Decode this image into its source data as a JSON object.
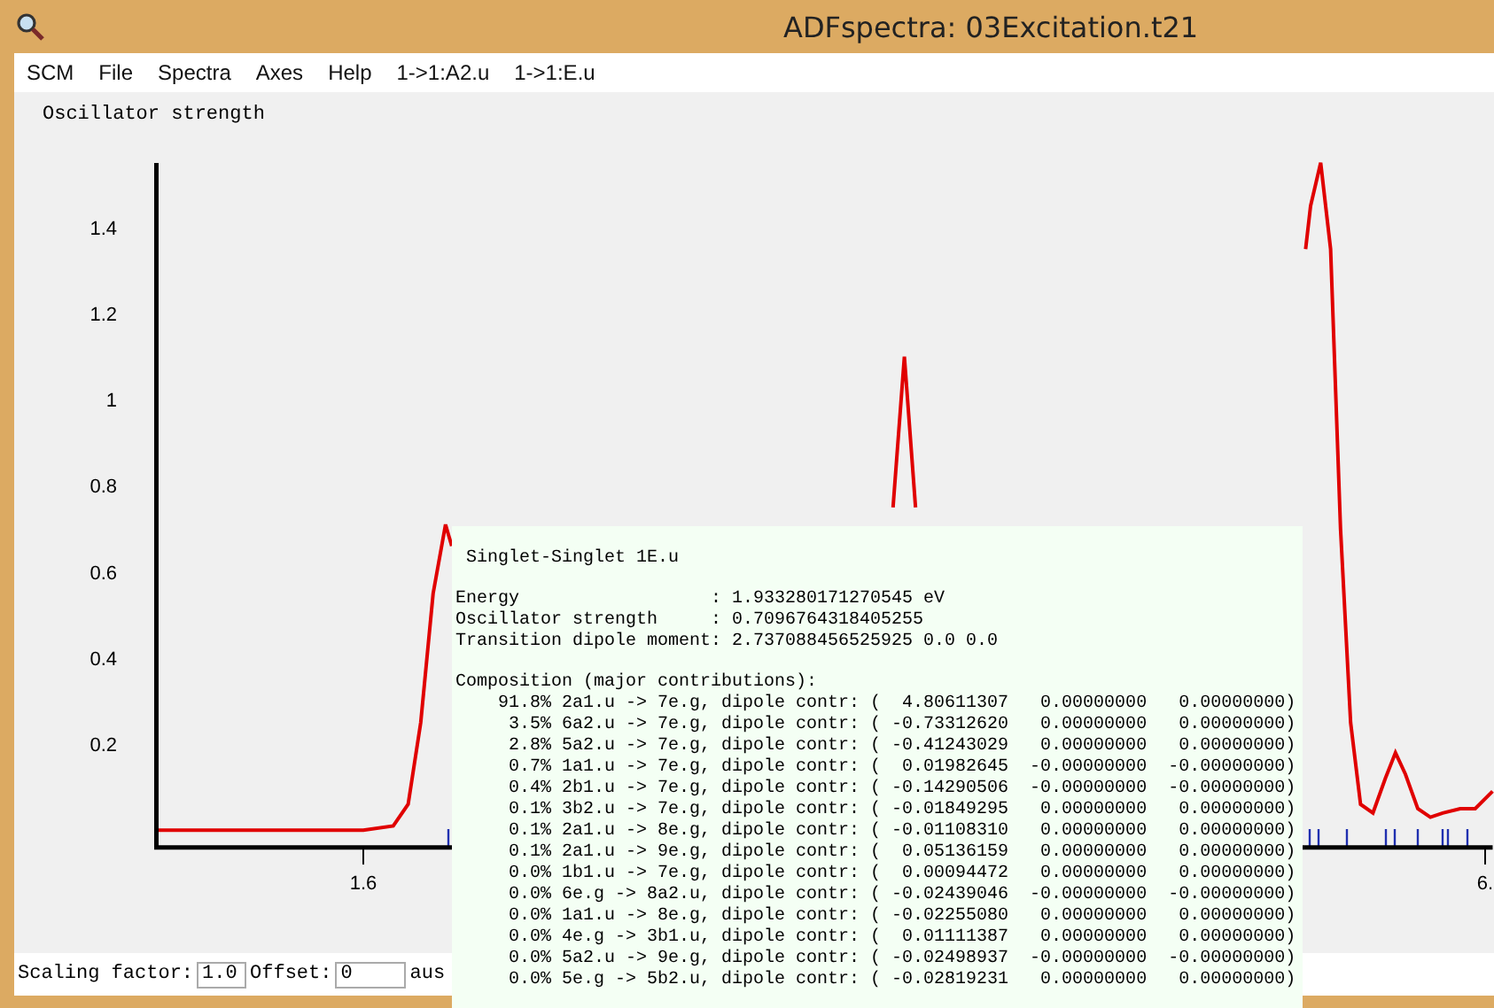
{
  "window": {
    "title": "ADFspectra: 03Excitation.t21"
  },
  "menu": [
    "SCM",
    "File",
    "Spectra",
    "Axes",
    "Help",
    "1->1:A2.u",
    "1->1:E.u"
  ],
  "plot": {
    "chart_data": {
      "type": "line",
      "ylabel": "Oscillator strength",
      "xlim": [
        0.77,
        6.13
      ],
      "ylim": [
        -0.04,
        1.55
      ],
      "yticks": [
        0.2,
        0.4,
        0.6,
        0.8,
        1.0,
        1.2,
        1.4
      ],
      "xticks": [
        1.6,
        {
          "value": 6.1,
          "label": "6."
        }
      ],
      "x": [
        0.77,
        1.6,
        1.72,
        1.78,
        1.83,
        1.88,
        1.93,
        1.955,
        2.0,
        3.7,
        3.725,
        3.77,
        3.815,
        3.84,
        5.0,
        5.38,
        5.4,
        5.44,
        5.48,
        5.52,
        5.56,
        5.6,
        5.65,
        5.7,
        5.74,
        5.78,
        5.83,
        5.88,
        5.93,
        6.0,
        6.06,
        6.13
      ],
      "series": [
        {
          "color": "#e00000",
          "values": [
            0,
            0,
            0.01,
            0.06,
            0.25,
            0.55,
            0.71,
            0.66,
            null,
            null,
            0.75,
            1.1,
            0.75,
            null,
            null,
            1.35,
            1.45,
            1.55,
            1.35,
            0.7,
            0.25,
            0.06,
            0.04,
            0.12,
            0.18,
            0.13,
            0.05,
            0.03,
            0.04,
            0.05,
            0.05,
            0.09
          ]
        }
      ]
    }
  },
  "bottom_bar": {
    "scaling_label": "Scaling factor:",
    "scaling_value": "1.0",
    "offset_label": "Offset:",
    "offset_value": "0",
    "gauss_label": "aus"
  },
  "popup": {
    "title": " Singlet-Singlet 1E.u",
    "properties": [
      "Energy                  : 1.933280171270545 eV",
      "Oscillator strength     : 0.7096764318405255",
      "Transition dipole moment: 2.737088456525925 0.0 0.0"
    ],
    "composition_title": "Composition (major contributions):",
    "composition": [
      "    91.8% 2a1.u -> 7e.g, dipole contr: (  4.80611307   0.00000000   0.00000000)",
      "     3.5% 6a2.u -> 7e.g, dipole contr: ( -0.73312620   0.00000000   0.00000000)",
      "     2.8% 5a2.u -> 7e.g, dipole contr: ( -0.41243029   0.00000000   0.00000000)",
      "     0.7% 1a1.u -> 7e.g, dipole contr: (  0.01982645  -0.00000000  -0.00000000)",
      "     0.4% 2b1.u -> 7e.g, dipole contr: ( -0.14290506  -0.00000000  -0.00000000)",
      "     0.1% 3b2.u -> 7e.g, dipole contr: ( -0.01849295   0.00000000   0.00000000)",
      "     0.1% 2a1.u -> 8e.g, dipole contr: ( -0.01108310   0.00000000   0.00000000)",
      "     0.1% 2a1.u -> 9e.g, dipole contr: (  0.05136159   0.00000000   0.00000000)",
      "     0.0% 1b1.u -> 7e.g, dipole contr: (  0.00094472   0.00000000   0.00000000)",
      "     0.0% 6e.g -> 8a2.u, dipole contr: ( -0.02439046  -0.00000000  -0.00000000)",
      "     0.0% 1a1.u -> 8e.g, dipole contr: ( -0.02255080   0.00000000   0.00000000)",
      "     0.0% 4e.g -> 3b1.u, dipole contr: (  0.01111387   0.00000000   0.00000000)",
      "     0.0% 5a2.u -> 9e.g, dipole contr: ( -0.02498937  -0.00000000  -0.00000000)",
      "     0.0% 5e.g -> 5b2.u, dipole contr: ( -0.02819231   0.00000000   0.00000000)"
    ]
  }
}
